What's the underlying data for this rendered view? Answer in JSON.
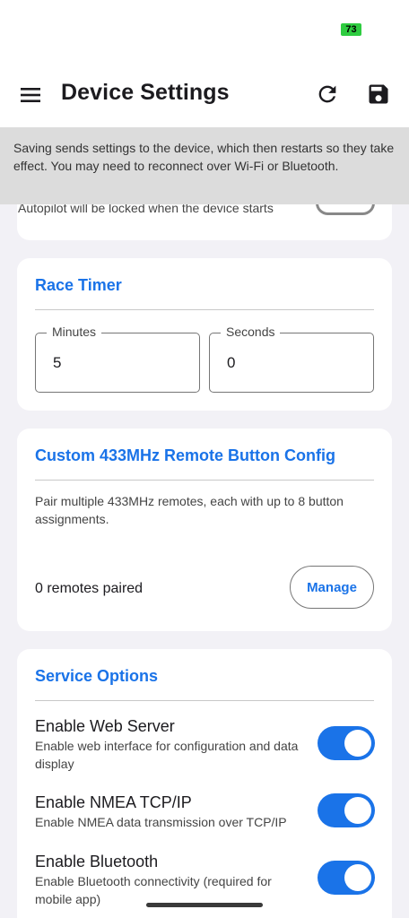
{
  "status_bar": {
    "battery": "73"
  },
  "app_bar": {
    "title": "Device Settings"
  },
  "info_banner": {
    "text": "Saving sends settings to the device, which then restarts so they take effect. You may need to reconnect over Wi-Fi or Bluetooth."
  },
  "autopilot_card": {
    "description": "Autopilot will be locked when the device starts"
  },
  "race_timer": {
    "title": "Race Timer",
    "minutes_label": "Minutes",
    "minutes_value": "5",
    "seconds_label": "Seconds",
    "seconds_value": "0"
  },
  "remote_config": {
    "title": "Custom 433MHz Remote Button Config",
    "description": "Pair multiple 433MHz remotes, each with up to 8 button assignments.",
    "count_text": "0 remotes paired",
    "manage_label": "Manage"
  },
  "service_options": {
    "title": "Service Options",
    "options": [
      {
        "title": "Enable Web Server",
        "description": "Enable web interface for configuration and data display",
        "enabled": true
      },
      {
        "title": "Enable NMEA TCP/IP",
        "description": "Enable NMEA data transmission over TCP/IP",
        "enabled": true
      },
      {
        "title": "Enable Bluetooth",
        "description": "Enable Bluetooth connectivity (required for mobile app)",
        "enabled": true
      }
    ]
  },
  "colors": {
    "accent": "#1a73e8",
    "background": "#f2f1f6",
    "banner": "#dcdcdc",
    "battery": "#2ecc40"
  }
}
